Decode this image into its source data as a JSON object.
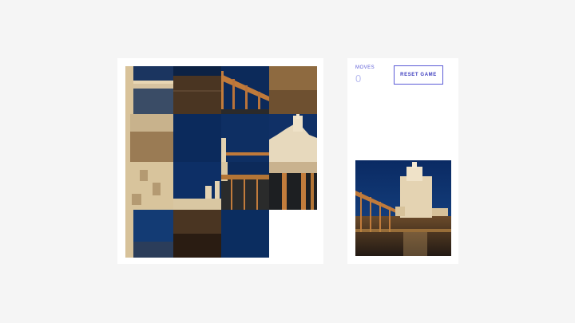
{
  "game": {
    "moves_label": "MOVES",
    "moves_value": "0",
    "reset_label": "RESET GAME",
    "grid": {
      "rows": 4,
      "cols": 4
    },
    "picture_name": "night-tower-by-water",
    "tiles_in_board_order": [
      {
        "piece": "4-0"
      },
      {
        "piece": "0-1"
      },
      {
        "piece": "2-2"
      },
      {
        "piece": "3-3"
      },
      {
        "piece": "1-0"
      },
      {
        "piece": "0-3"
      },
      {
        "piece": "1-2"
      },
      {
        "piece": "1-3"
      },
      {
        "piece": "2-0"
      },
      {
        "piece": "2-1"
      },
      {
        "piece": "2-2b"
      },
      {
        "piece": "2-3"
      },
      {
        "piece": "3-0"
      },
      {
        "piece": "3-1"
      },
      {
        "piece": "3-2"
      },
      {
        "piece": "empty"
      }
    ]
  },
  "colors": {
    "accent": "#5b5bd6",
    "sky_night": "#0c2a5a",
    "stone_lit": "#e2c89a",
    "water_glow": "#b07a3a"
  }
}
